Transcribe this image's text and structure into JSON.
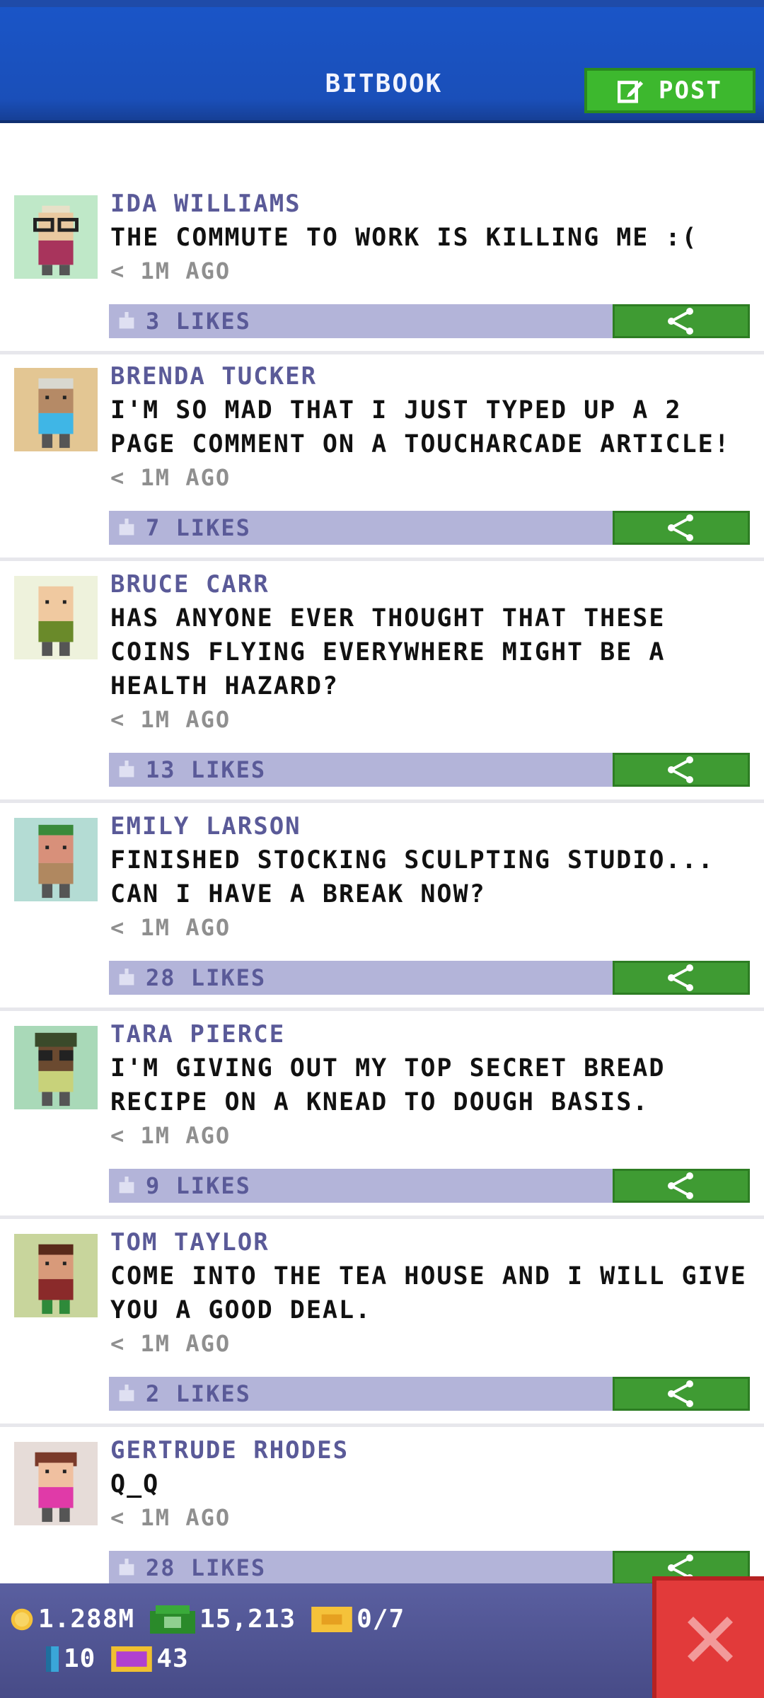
{
  "header": {
    "title": "BITBOOK",
    "post_label": "POST"
  },
  "feed": [
    {
      "name": "IDA WILLIAMS",
      "text": "THE COMMUTE TO WORK IS KILLING ME :(",
      "time": "< 1M AGO",
      "likes": "3 LIKES",
      "avatar_bg": "#bfe8c8"
    },
    {
      "name": "BRENDA TUCKER",
      "text": "I'M SO MAD THAT I JUST TYPED UP A 2 PAGE COMMENT ON A TOUCHARCADE ARTICLE!",
      "time": "< 1M AGO",
      "likes": "7 LIKES",
      "avatar_bg": "#e3c693"
    },
    {
      "name": "BRUCE CARR",
      "text": "HAS ANYONE EVER THOUGHT THAT THESE COINS FLYING EVERYWHERE MIGHT BE A HEALTH HAZARD?",
      "time": "< 1M AGO",
      "likes": "13 LIKES",
      "avatar_bg": "#eef2dc"
    },
    {
      "name": "EMILY LARSON",
      "text": "FINISHED STOCKING SCULPTING STUDIO... CAN I HAVE A BREAK NOW?",
      "time": "< 1M AGO",
      "likes": "28 LIKES",
      "avatar_bg": "#b4dcd4"
    },
    {
      "name": "TARA PIERCE",
      "text": "I'M GIVING OUT MY TOP SECRET BREAD RECIPE ON A KNEAD TO DOUGH BASIS.",
      "time": "< 1M AGO",
      "likes": "9 LIKES",
      "avatar_bg": "#a9d9b8"
    },
    {
      "name": "TOM TAYLOR",
      "text": "COME INTO THE TEA HOUSE AND I WILL GIVE YOU A GOOD DEAL.",
      "time": "< 1M AGO",
      "likes": "2 LIKES",
      "avatar_bg": "#c8d59c"
    },
    {
      "name": "GERTRUDE RHODES",
      "text": "Q_Q",
      "time": "< 1M AGO",
      "likes": "28 LIKES",
      "avatar_bg": "#e6dcd8"
    }
  ],
  "bottom_bar": {
    "coins": "1.288M",
    "cash": "15,213",
    "tickets": "0/7",
    "bits": "10",
    "bux": "43"
  },
  "colors": {
    "header_blue": "#1a4fb9",
    "post_green": "#3db82e",
    "like_bar": "#b3b4d9",
    "share_green": "#3f9b33",
    "close_red": "#e23a3a",
    "name_purple": "#5a5a98"
  },
  "icons": {
    "post": "compose-icon",
    "like": "thumbs-up-icon",
    "share": "share-icon",
    "coin": "coin-icon",
    "cash": "cash-icon",
    "ticket": "ticket-icon",
    "bit": "bit-icon",
    "bux": "bux-icon",
    "close": "close-icon"
  }
}
